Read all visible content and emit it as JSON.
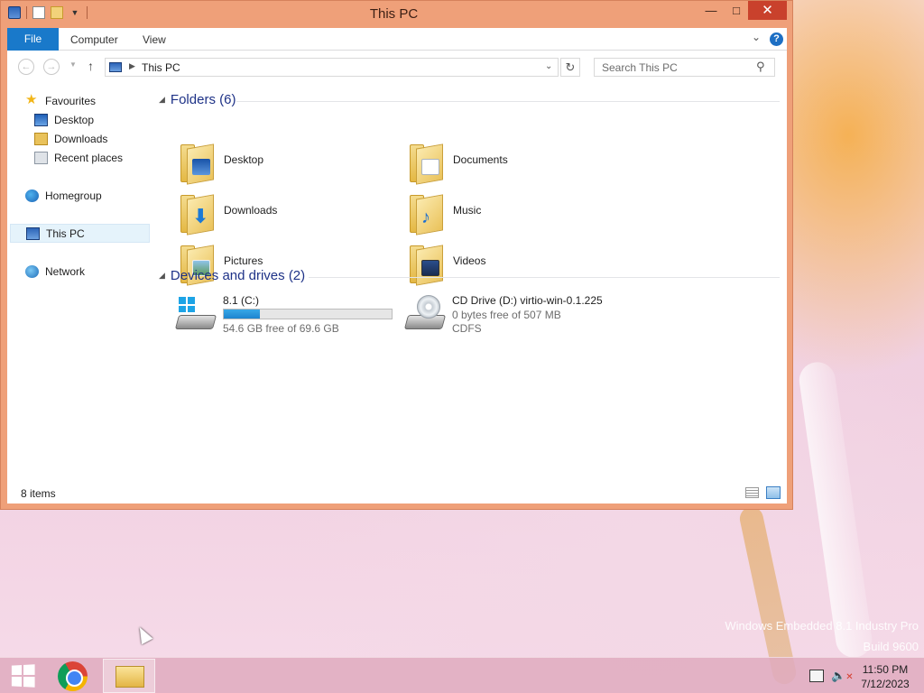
{
  "window": {
    "title": "This PC",
    "buttons": {
      "minimize": "—",
      "maximize": "□",
      "close": "✕"
    }
  },
  "ribbon": {
    "tabs": [
      {
        "label": "File"
      },
      {
        "label": "Computer"
      },
      {
        "label": "View"
      }
    ],
    "help": "?"
  },
  "addressbar": {
    "path": "This PC",
    "search_placeholder": "Search This PC"
  },
  "navpane": {
    "favourites": "Favourites",
    "desktop": "Desktop",
    "downloads": "Downloads",
    "recent": "Recent places",
    "homegroup": "Homegroup",
    "thispc": "This PC",
    "network": "Network"
  },
  "folders_group": {
    "header": "Folders (6)",
    "items": [
      {
        "label": "Desktop",
        "icon": "desktop-folder-icon"
      },
      {
        "label": "Documents",
        "icon": "documents-folder-icon"
      },
      {
        "label": "Downloads",
        "icon": "downloads-folder-icon"
      },
      {
        "label": "Music",
        "icon": "music-folder-icon"
      },
      {
        "label": "Pictures",
        "icon": "pictures-folder-icon"
      },
      {
        "label": "Videos",
        "icon": "videos-folder-icon"
      }
    ]
  },
  "devices_group": {
    "header": "Devices and drives (2)",
    "drives": [
      {
        "name": "8.1 (C:)",
        "free": "54.6 GB free of 69.6 GB",
        "used_fraction": 0.216,
        "icon": "hard-drive-icon"
      },
      {
        "name": "CD Drive (D:) virtio-win-0.1.225",
        "free": "0 bytes free of 507 MB",
        "fs": "CDFS",
        "icon": "cd-drive-icon"
      }
    ]
  },
  "statusbar": {
    "items": "8 items"
  },
  "desktop": {
    "watermark_line1": "Windows Embedded 8.1 Industry Pro",
    "watermark_line2": "Build 9600"
  },
  "taskbar": {
    "time": "11:50 PM",
    "date": "7/12/2023"
  },
  "colors": {
    "window_frame": "#efa079",
    "accent": "#1979ca",
    "close_button": "#c9412c",
    "drive_bar": "#26a0da"
  }
}
